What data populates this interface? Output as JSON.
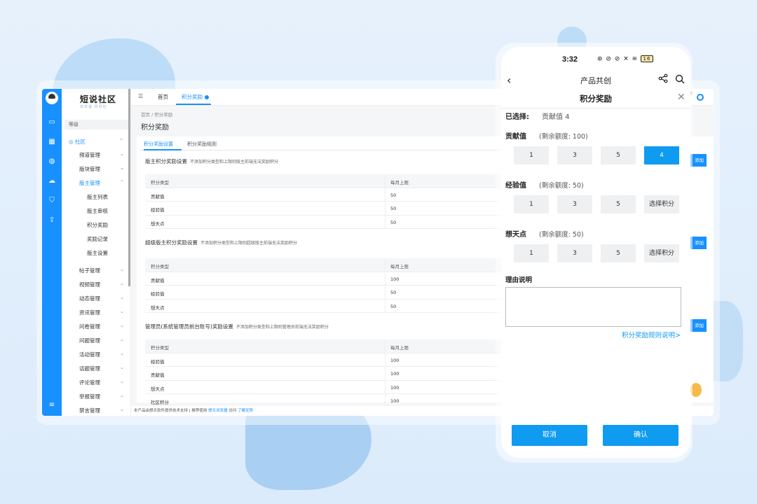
{
  "desktop": {
    "logo": "短说社区",
    "logo_sub": "日日说·月月社",
    "side_search": "等级",
    "menu": [
      {
        "label": "社区",
        "top": 0
      },
      {
        "label": "频道管理"
      },
      {
        "label": "版块管理"
      },
      {
        "label": "版主管理"
      }
    ],
    "menu_community": "社区",
    "menu_channel": "频道管理",
    "menu_board": "版块管理",
    "menu_moderator": "版主管理",
    "sub_list": "版主列表",
    "sub_review": "版主审核",
    "sub_reward": "积分奖励",
    "sub_record": "奖励记录",
    "sub_setting": "版主设置",
    "more_menu": [
      "帖子管理",
      "视频管理",
      "动态管理",
      "资讯管理",
      "问卷管理",
      "问题管理",
      "活动管理",
      "话题管理",
      "评论管理",
      "举报管理",
      "禁言管理"
    ],
    "tabs_home": "首页",
    "tabs_active": "积分奖励",
    "crumb": "首页  /  积分奖励",
    "page_title": "积分奖励",
    "subtab_settings": "积分奖励设置",
    "subtab_rules": "积分奖励规则",
    "col_type": "积分类型",
    "col_limit": "每月上限",
    "sec1_title": "版主积分奖励设置",
    "sec1_note": "不添加积分类型和上限则版主前端无法奖励积分",
    "sec1_rows": [
      [
        "贡献值",
        "50"
      ],
      [
        "经验值",
        "50"
      ],
      [
        "想天点",
        "50"
      ]
    ],
    "sec2_title": "超级版主积分奖励设置",
    "sec2_note": "不添加积分类型和上限则超级版主前端无法奖励积分",
    "sec2_rows": [
      [
        "贡献值",
        "100"
      ],
      [
        "经验值",
        "50"
      ],
      [
        "想天点",
        "50"
      ]
    ],
    "sec3_title": "管理员(系统管理员前台账号)奖励设置",
    "sec3_note": "不添加积分类型和上限则管理员前端无法奖励积分",
    "sec3_rows": [
      [
        "经验值",
        "100"
      ],
      [
        "贡献值",
        "100"
      ],
      [
        "想天点",
        "100"
      ],
      [
        "社区积分",
        "100"
      ]
    ],
    "add_label": "添加",
    "footer_text": "本产品由想天软件提供技术支持  |  推荐使用",
    "footer_link": "想天浏览器",
    "footer_tail": "访问",
    "footer_more": "了解优势"
  },
  "phone": {
    "time": "3:32",
    "status": "⊛ ⊘ ⊘ ✕ ≋ ",
    "battery": "16",
    "nav_title": "产品共创",
    "modal_title": "积分奖励",
    "selected_label": "已选择:",
    "selected_value": "贡献值 4",
    "groups": {
      "contrib": {
        "label": "贡献值",
        "quota": "(剩余额度: 100)",
        "options": [
          "1",
          "3",
          "5",
          "4"
        ]
      },
      "exp": {
        "label": "经验值",
        "quota": "(剩余额度: 50)",
        "options": [
          "1",
          "3",
          "5",
          "选择积分"
        ]
      },
      "xtd": {
        "label": "想天点",
        "quota": "(剩余额度: 50)",
        "options": [
          "1",
          "3",
          "5",
          "选择积分"
        ]
      }
    },
    "reason_label": "理由说明",
    "rules_link": "积分奖励规则说明>",
    "cancel": "取消",
    "confirm": "确认"
  }
}
